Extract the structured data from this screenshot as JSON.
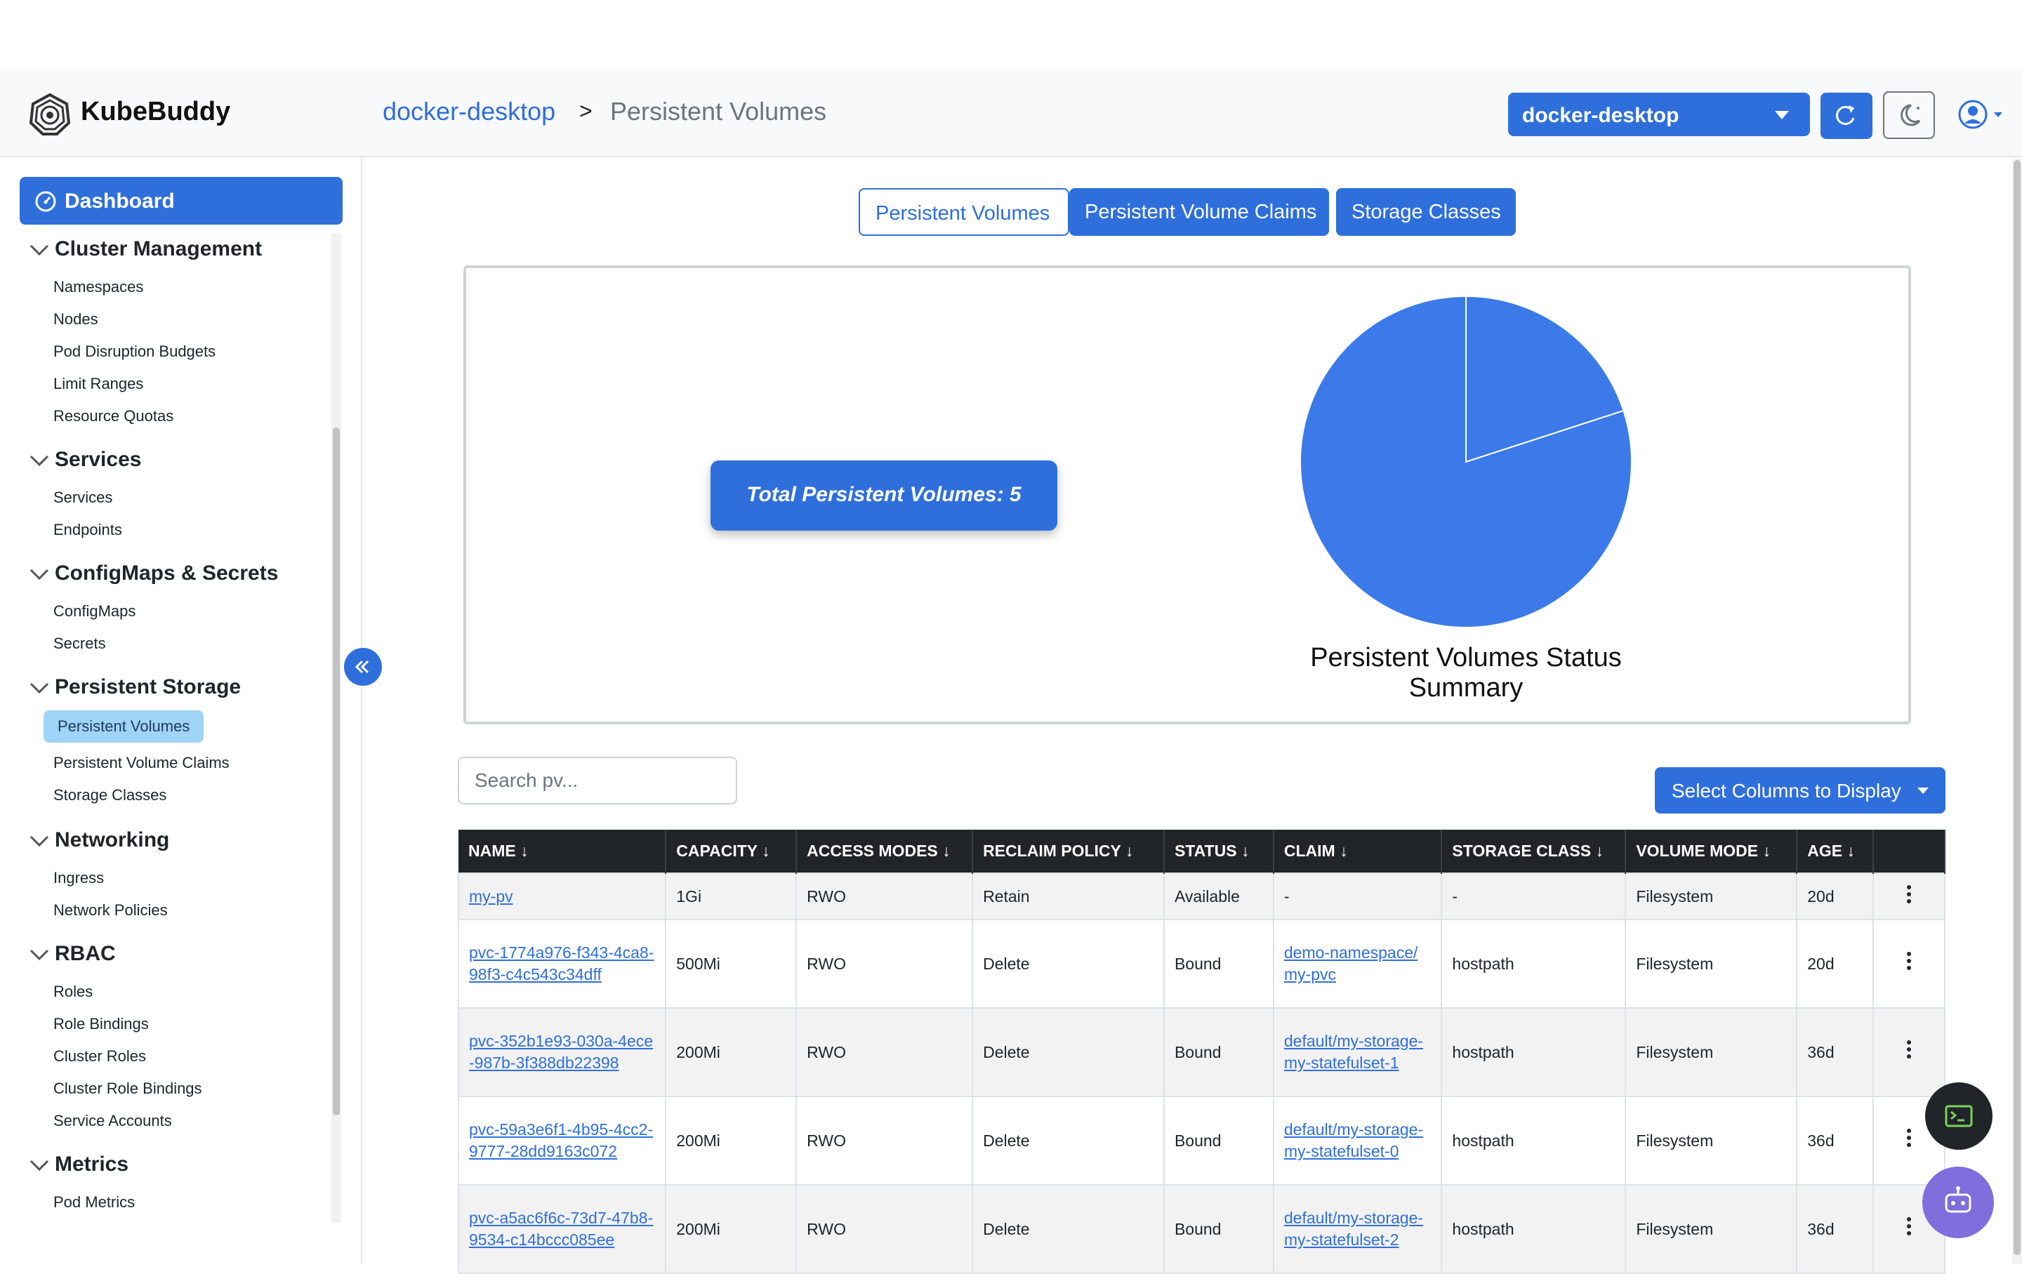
{
  "app": {
    "name": "KubeBuddy"
  },
  "breadcrumb": {
    "cluster": "docker-desktop",
    "separator": ">",
    "current": "Persistent Volumes"
  },
  "header": {
    "context_selected": "docker-desktop"
  },
  "sidebar": {
    "dashboard_label": "Dashboard",
    "sections": [
      {
        "title": "Cluster Management",
        "items": [
          "Namespaces",
          "Nodes",
          "Pod Disruption Budgets",
          "Limit Ranges",
          "Resource Quotas"
        ]
      },
      {
        "title": "Services",
        "items": [
          "Services",
          "Endpoints"
        ]
      },
      {
        "title": "ConfigMaps & Secrets",
        "items": [
          "ConfigMaps",
          "Secrets"
        ]
      },
      {
        "title": "Persistent Storage",
        "items": [
          "Persistent Volumes",
          "Persistent Volume Claims",
          "Storage Classes"
        ]
      },
      {
        "title": "Networking",
        "items": [
          "Ingress",
          "Network Policies"
        ]
      },
      {
        "title": "RBAC",
        "items": [
          "Roles",
          "Role Bindings",
          "Cluster Roles",
          "Cluster Role Bindings",
          "Service Accounts"
        ]
      },
      {
        "title": "Metrics",
        "items": [
          "Pod Metrics"
        ]
      }
    ],
    "active_item": "Persistent Volumes"
  },
  "tabs": [
    "Persistent Volumes",
    "Persistent Volume Claims",
    "Storage Classes"
  ],
  "summary": {
    "total_label": "Total Persistent Volumes: 5"
  },
  "chart_data": {
    "type": "pie",
    "title": "Persistent Volumes Status Summary",
    "series": [
      {
        "values": [
          1,
          4
        ]
      }
    ],
    "colors": [
      "#3b7ae8",
      "#3b7ae8"
    ]
  },
  "search": {
    "placeholder": "Search pv..."
  },
  "columns_button": "Select Columns to Display",
  "table": {
    "headers": [
      "NAME ↓",
      "CAPACITY ↓",
      "ACCESS MODES ↓",
      "RECLAIM POLICY ↓",
      "STATUS ↓",
      "CLAIM ↓",
      "STORAGE CLASS ↓",
      "VOLUME MODE ↓",
      "AGE ↓"
    ],
    "rows": [
      {
        "name": "my-pv",
        "capacity": "1Gi",
        "access": "RWO",
        "reclaim": "Retain",
        "status": "Available",
        "claim": "-",
        "storage_class": "-",
        "mode": "Filesystem",
        "age": "20d"
      },
      {
        "name": "pvc-1774a976-f343-4ca8-98f3-c4c543c34dff",
        "capacity": "500Mi",
        "access": "RWO",
        "reclaim": "Delete",
        "status": "Bound",
        "claim": "demo-namespace/my-pvc",
        "storage_class": "hostpath",
        "mode": "Filesystem",
        "age": "20d"
      },
      {
        "name": "pvc-352b1e93-030a-4ece-987b-3f388db22398",
        "capacity": "200Mi",
        "access": "RWO",
        "reclaim": "Delete",
        "status": "Bound",
        "claim": "default/my-storage-my-statefulset-1",
        "storage_class": "hostpath",
        "mode": "Filesystem",
        "age": "36d"
      },
      {
        "name": "pvc-59a3e6f1-4b95-4cc2-9777-28dd9163c072",
        "capacity": "200Mi",
        "access": "RWO",
        "reclaim": "Delete",
        "status": "Bound",
        "claim": "default/my-storage-my-statefulset-0",
        "storage_class": "hostpath",
        "mode": "Filesystem",
        "age": "36d"
      },
      {
        "name": "pvc-a5ac6f6c-73d7-47b8-9534-c14bccc085ee",
        "capacity": "200Mi",
        "access": "RWO",
        "reclaim": "Delete",
        "status": "Bound",
        "claim": "default/my-storage-my-statefulset-2",
        "storage_class": "hostpath",
        "mode": "Filesystem",
        "age": "36d"
      }
    ]
  },
  "icons": [
    "kubebuddy-logo-icon",
    "refresh-icon",
    "moon-icon",
    "user-icon",
    "dashboard-icon",
    "chevron-down-icon",
    "collapse-icon",
    "kebab-menu-icon",
    "terminal-icon",
    "bot-icon"
  ]
}
